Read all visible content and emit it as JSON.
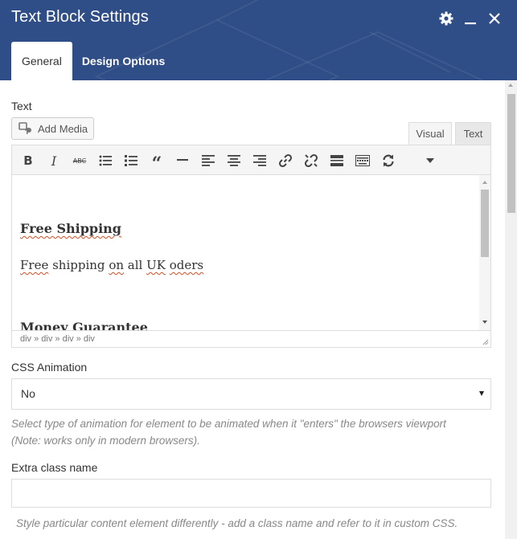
{
  "window": {
    "title": "Text Block Settings",
    "icons": {
      "settings": "gear-icon",
      "minimize": "minimize-icon",
      "close": "close-icon"
    }
  },
  "tabs": [
    {
      "label": "General",
      "active": true
    },
    {
      "label": "Design Options",
      "active": false
    }
  ],
  "text_field": {
    "label": "Text",
    "add_media_label": "Add Media",
    "editor_tabs": {
      "visual": "Visual",
      "text": "Text",
      "active": "visual"
    },
    "toolbar": [
      "bold-icon",
      "italic-icon",
      "strikethrough-icon",
      "bullet-list-icon",
      "numbered-list-icon",
      "blockquote-icon",
      "horizontal-rule-icon",
      "align-left-icon",
      "align-center-icon",
      "align-right-icon",
      "link-icon",
      "unlink-icon",
      "read-more-icon",
      "toolbar-toggle-icon",
      "refresh-icon",
      "dropdown-arrow-icon"
    ],
    "content": {
      "heading1": "Free Shipping",
      "para1_parts": [
        "Free",
        " shipping ",
        "on",
        " all ",
        "UK",
        " ",
        "oders"
      ],
      "heading2": "Money Guarantee"
    },
    "path": "div » div » div » div"
  },
  "css_animation": {
    "label": "CSS Animation",
    "selected": "No",
    "help_line1": "Select type of animation for element to be animated when it \"enters\" the browsers viewport",
    "help_line2": "(Note: works only in modern browsers)."
  },
  "extra_class": {
    "label": "Extra class name",
    "value": "",
    "placeholder": "",
    "help": "Style particular content element differently - add a class name and refer to it in custom CSS."
  },
  "colors": {
    "header": "#2f4d86",
    "accent": "#2f4d86"
  }
}
